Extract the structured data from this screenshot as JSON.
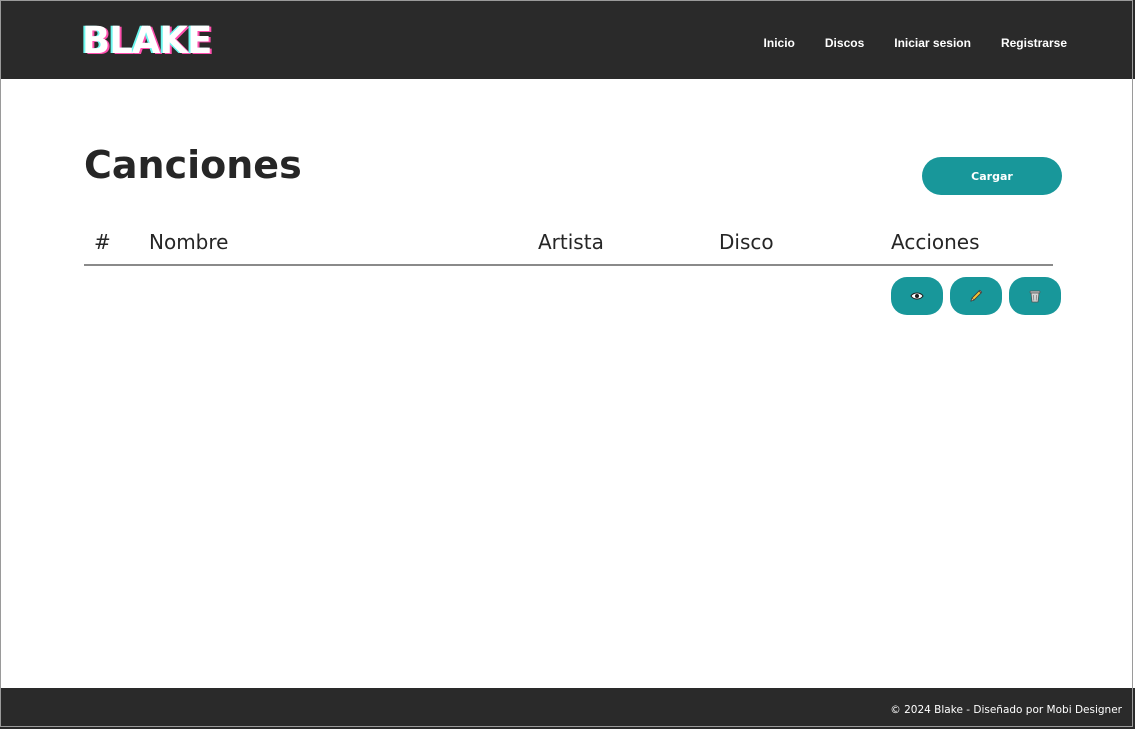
{
  "header": {
    "logo": "BLAKE",
    "nav": [
      "Inicio",
      "Discos",
      "Iniciar sesion",
      "Registrarse"
    ]
  },
  "main": {
    "title": "Canciones",
    "load_button": "Cargar",
    "table": {
      "columns": [
        "#",
        "Nombre",
        "Artista",
        "Disco",
        "Acciones"
      ],
      "actions": [
        "eye-icon",
        "pencil-icon",
        "trash-icon"
      ]
    }
  },
  "footer": {
    "copyright": "© 2024 Blake - Diseñado por Mobi Designer"
  },
  "colors": {
    "header_bg": "#2a2a2a",
    "accent": "#18979a"
  }
}
